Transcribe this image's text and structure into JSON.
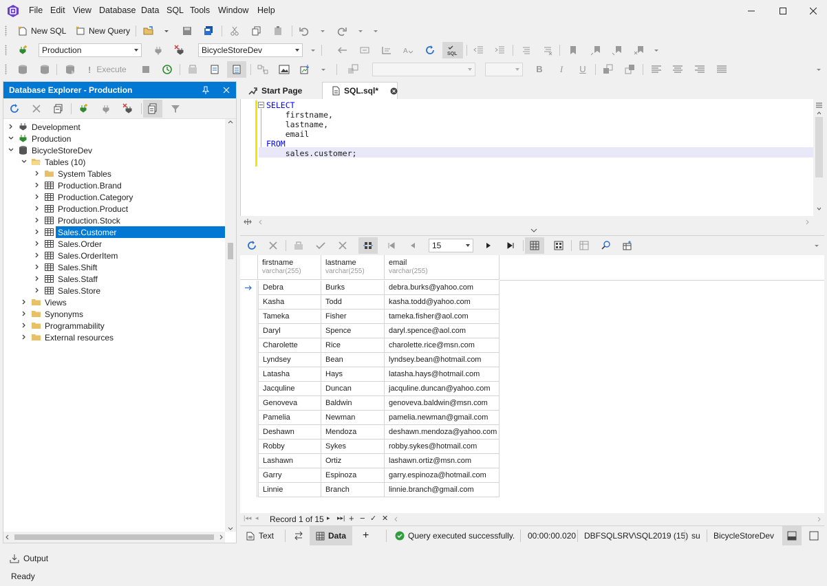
{
  "menu": [
    "File",
    "Edit",
    "View",
    "Database",
    "Data",
    "SQL",
    "Tools",
    "Window",
    "Help"
  ],
  "toolbar1": {
    "new_sql": "New SQL",
    "new_query": "New Query"
  },
  "toolbar2": {
    "connection": "Production",
    "database": "BicycleStoreDev"
  },
  "toolbar3": {
    "execute": "Execute",
    "font_name": "",
    "font_size": ""
  },
  "explorer": {
    "title": "Database Explorer - Production",
    "tree": [
      {
        "label": "Development",
        "level": 0,
        "icon": "connection-icon",
        "expanded": false
      },
      {
        "label": "Production",
        "level": 0,
        "icon": "connection-active-icon",
        "expanded": true
      },
      {
        "label": "BicycleStoreDev",
        "level": 1,
        "icon": "database-icon",
        "expanded": true
      },
      {
        "label": "Tables (10)",
        "level": 2,
        "icon": "folder-open-icon",
        "expanded": true
      },
      {
        "label": "System Tables",
        "level": 3,
        "icon": "folder-icon",
        "expanded": false
      },
      {
        "label": "Production.Brand",
        "level": 3,
        "icon": "table-icon",
        "expanded": false
      },
      {
        "label": "Production.Category",
        "level": 3,
        "icon": "table-icon",
        "expanded": false
      },
      {
        "label": "Production.Product",
        "level": 3,
        "icon": "table-icon",
        "expanded": false
      },
      {
        "label": "Production.Stock",
        "level": 3,
        "icon": "table-icon",
        "expanded": false
      },
      {
        "label": "Sales.Customer",
        "level": 3,
        "icon": "table-icon",
        "expanded": false,
        "selected": true
      },
      {
        "label": "Sales.Order",
        "level": 3,
        "icon": "table-icon",
        "expanded": false
      },
      {
        "label": "Sales.OrderItem",
        "level": 3,
        "icon": "table-icon",
        "expanded": false
      },
      {
        "label": "Sales.Shift",
        "level": 3,
        "icon": "table-icon",
        "expanded": false
      },
      {
        "label": "Sales.Staff",
        "level": 3,
        "icon": "table-icon",
        "expanded": false
      },
      {
        "label": "Sales.Store",
        "level": 3,
        "icon": "table-icon",
        "expanded": false
      },
      {
        "label": "Views",
        "level": 2,
        "icon": "folder-icon",
        "expanded": false
      },
      {
        "label": "Synonyms",
        "level": 2,
        "icon": "folder-icon",
        "expanded": false
      },
      {
        "label": "Programmability",
        "level": 2,
        "icon": "folder-icon",
        "expanded": false
      },
      {
        "label": "External resources",
        "level": 2,
        "icon": "folder-icon",
        "expanded": false
      }
    ]
  },
  "tabs": [
    {
      "label": "Start Page",
      "active": false
    },
    {
      "label": "SQL.sql*",
      "active": true
    }
  ],
  "editor": {
    "lines": [
      {
        "parts": [
          {
            "t": "SELECT",
            "kw": true
          }
        ]
      },
      {
        "parts": [
          {
            "t": "    firstname,",
            "kw": false
          }
        ]
      },
      {
        "parts": [
          {
            "t": "    lastname,",
            "kw": false
          }
        ]
      },
      {
        "parts": [
          {
            "t": "    email",
            "kw": false
          }
        ]
      },
      {
        "parts": [
          {
            "t": "FROM",
            "kw": true
          }
        ]
      },
      {
        "parts": [
          {
            "t": "    sales.customer;",
            "kw": false
          }
        ]
      }
    ]
  },
  "results": {
    "page_size": "15",
    "columns": [
      {
        "name": "firstname",
        "type": "varchar(255)"
      },
      {
        "name": "lastname",
        "type": "varchar(255)"
      },
      {
        "name": "email",
        "type": "varchar(255)"
      }
    ],
    "rows": [
      [
        "Debra",
        "Burks",
        "debra.burks@yahoo.com"
      ],
      [
        "Kasha",
        "Todd",
        "kasha.todd@yahoo.com"
      ],
      [
        "Tameka",
        "Fisher",
        "tameka.fisher@aol.com"
      ],
      [
        "Daryl",
        "Spence",
        "daryl.spence@aol.com"
      ],
      [
        "Charolette",
        "Rice",
        "charolette.rice@msn.com"
      ],
      [
        "Lyndsey",
        "Bean",
        "lyndsey.bean@hotmail.com"
      ],
      [
        "Latasha",
        "Hays",
        "latasha.hays@hotmail.com"
      ],
      [
        "Jacquline",
        "Duncan",
        "jacquline.duncan@yahoo.com"
      ],
      [
        "Genoveva",
        "Baldwin",
        "genoveva.baldwin@msn.com"
      ],
      [
        "Pamelia",
        "Newman",
        "pamelia.newman@gmail.com"
      ],
      [
        "Deshawn",
        "Mendoza",
        "deshawn.mendoza@yahoo.com"
      ],
      [
        "Robby",
        "Sykes",
        "robby.sykes@hotmail.com"
      ],
      [
        "Lashawn",
        "Ortiz",
        "lashawn.ortiz@msn.com"
      ],
      [
        "Garry",
        "Espinoza",
        "garry.espinoza@hotmail.com"
      ],
      [
        "Linnie",
        "Branch",
        "linnie.branch@gmail.com"
      ]
    ],
    "record_nav": "Record 1 of 15"
  },
  "bottom": {
    "text_tab": "Text",
    "data_tab": "Data",
    "status_msg": "Query executed successfully.",
    "elapsed": "00:00:00.020",
    "server": "DBFSQLSRV\\SQL2019 (15)",
    "user": "su",
    "database": "BicycleStoreDev"
  },
  "output_label": "Output",
  "status_ready": "Ready",
  "colors": {
    "accent": "#0078d4",
    "keyword": "#0000ff",
    "success": "#2e9e3f",
    "logo": "#6b3fd4"
  }
}
